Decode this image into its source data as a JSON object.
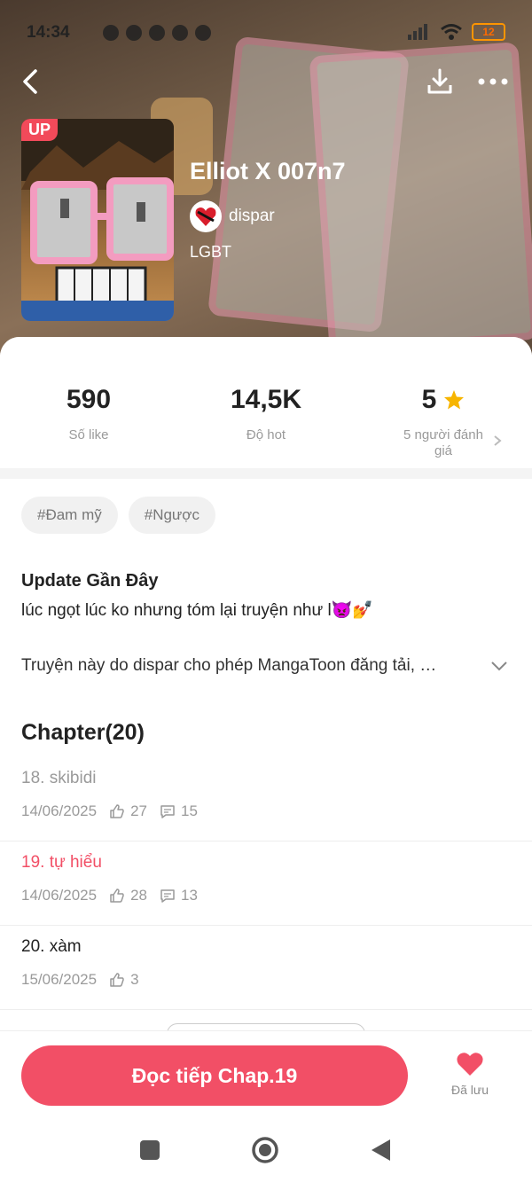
{
  "status_bar": {
    "time": "14:34",
    "battery": "12",
    "accent_color": "#ff9500"
  },
  "toolbar": {
    "back_icon": "back-arrow-icon",
    "download_icon": "download-icon",
    "more_icon": "more-dots-icon"
  },
  "book": {
    "badge": "UP",
    "title": "Elliot X 007n7",
    "author": "dispar",
    "genre": "LGBT"
  },
  "stats": [
    {
      "value": "590",
      "label": "Số like"
    },
    {
      "value": "14,5K",
      "label": "Độ hot"
    },
    {
      "value": "5",
      "label": "5 người đánh giá"
    }
  ],
  "tags": [
    "#Đam mỹ",
    "#Ngược"
  ],
  "update": {
    "heading": "Update Gần Đây",
    "text": "lúc ngọt lúc ko nhưng tóm lại truyện như l👿💅"
  },
  "description": "Truyện này do dispar cho phép MangaToon đăng tải, …",
  "chapters": {
    "heading": "Chapter(20)",
    "items": [
      {
        "title": "18. skibidi",
        "date": "14/06/2025",
        "likes": "27",
        "comments": "15",
        "state": "read"
      },
      {
        "title": "19. tự hiểu",
        "date": "14/06/2025",
        "likes": "28",
        "comments": "13",
        "state": "current"
      },
      {
        "title": "20. xàm",
        "date": "15/06/2025",
        "likes": "3",
        "comments": "",
        "state": "unread"
      }
    ]
  },
  "actions": {
    "read_button": "Đọc tiếp Chap.19",
    "saved_label": "Đã lưu",
    "brand_color": "#f24f66"
  }
}
